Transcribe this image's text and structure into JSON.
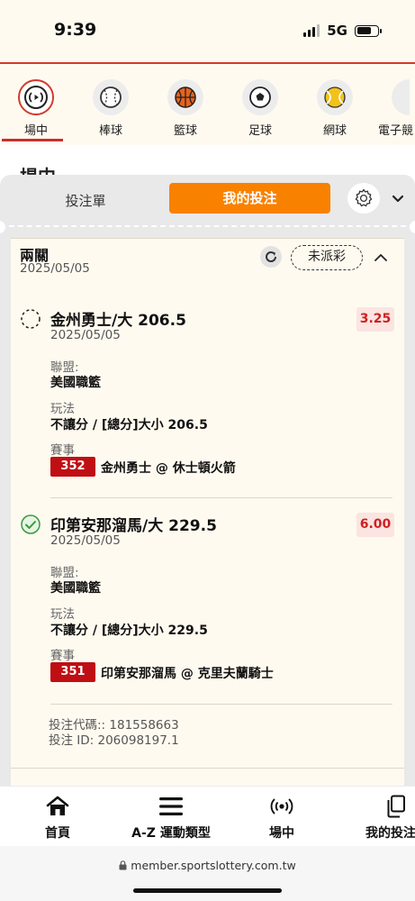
{
  "status_bar": {
    "time": "9:39",
    "network": "5G"
  },
  "sports_nav": [
    {
      "label": "場中",
      "icon": "live-broadcast-icon",
      "active": true
    },
    {
      "label": "棒球",
      "icon": "baseball-icon"
    },
    {
      "label": "籃球",
      "icon": "basketball-icon"
    },
    {
      "label": "足球",
      "icon": "soccer-ball-icon"
    },
    {
      "label": "網球",
      "icon": "tennis-ball-icon"
    },
    {
      "label": "電子競",
      "icon": "esports-icon"
    }
  ],
  "page": {
    "title_behind": "場中"
  },
  "sheet": {
    "tabs": {
      "bet_slip": "投注單",
      "my_bets": "我的投注"
    }
  },
  "bet": {
    "type": "兩關",
    "date": "2025/05/05",
    "status": "未派彩",
    "legs": [
      {
        "selection": "金州勇士/大 206.5",
        "date": "2025/05/05",
        "odds": "3.25",
        "state": "pending",
        "league_label": "聯盟:",
        "league": "美國職籃",
        "market_label": "玩法",
        "market": "不讓分 / [總分]大小 206.5",
        "event_label": "賽事",
        "event_no": "352",
        "event_name": "金州勇士 @ 休士頓火箭"
      },
      {
        "selection": "印第安那溜馬/大 229.5",
        "date": "2025/05/05",
        "odds": "6.00",
        "state": "won",
        "league_label": "聯盟:",
        "league": "美國職籃",
        "market_label": "玩法",
        "market": "不讓分 / [總分]大小 229.5",
        "event_label": "賽事",
        "event_no": "351",
        "event_name": "印第安那溜馬 @ 克里夫蘭騎士"
      }
    ],
    "bet_code": "投注代碼:: 181558663",
    "bet_id": "投注 ID: 206098197.1"
  },
  "bottom_nav": [
    {
      "label": "首頁",
      "icon": "home-icon"
    },
    {
      "label": "A-Z 運動類型",
      "icon": "menu-icon"
    },
    {
      "label": "場中",
      "icon": "live-broadcast-icon"
    },
    {
      "label": "我的投注",
      "icon": "bets-copy-icon"
    }
  ],
  "browser": {
    "url": "member.sportslottery.com.tw"
  },
  "colors": {
    "accent": "#f98100",
    "brand_red": "#c00f14",
    "odds_red": "#cc2222",
    "won_green": "#3a9a3a"
  }
}
